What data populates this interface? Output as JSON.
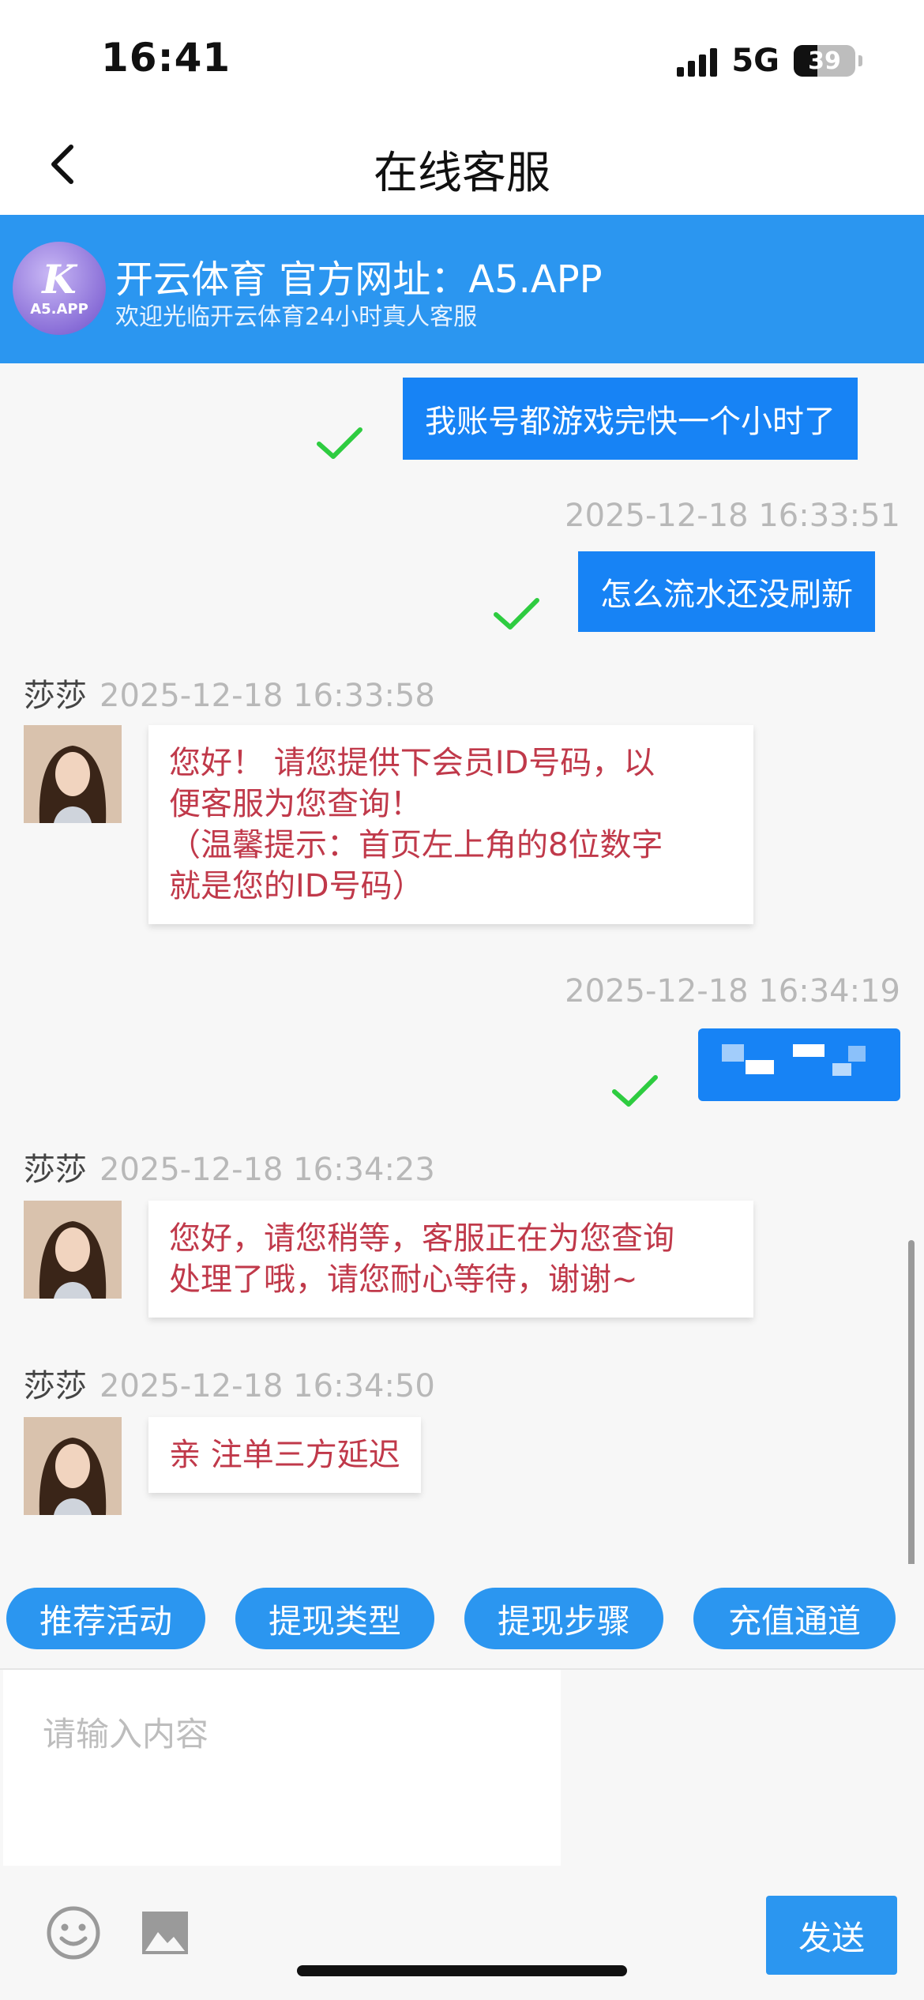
{
  "status": {
    "time": "16:41",
    "network": "5G",
    "battery": "39",
    "battery_level": 0.39
  },
  "nav": {
    "title": "在线客服"
  },
  "brand": {
    "logo_mark": "K",
    "logo_text": "A5.APP",
    "title": "开云体育 官方网址：A5.APP",
    "subtitle": "欢迎光临开云体育24小时真人客服"
  },
  "messages": {
    "me1": {
      "text": "我账号都游戏完快一个小时了"
    },
    "me2": {
      "time": "2025-12-18 16:33:51",
      "text": "怎么流水还没刷新"
    },
    "agent1": {
      "name": "莎莎",
      "time": "2025-12-18 16:33:58",
      "lines": [
        "您好！ 请您提供下会员ID号码，以",
        "便客服为您查询！",
        "（温馨提示：首页左上角的8位数字",
        "就是您的ID号码）"
      ]
    },
    "me3": {
      "time": "2025-12-18 16:34:19"
    },
    "agent2": {
      "name": "莎莎",
      "time": "2025-12-18 16:34:23",
      "lines": [
        "您好，请您稍等，客服正在为您查询",
        "处理了哦，请您耐心等待，谢谢~"
      ]
    },
    "agent3": {
      "name": "莎莎",
      "time": "2025-12-18 16:34:50",
      "text": "亲 注单三方延迟"
    }
  },
  "quick_replies": [
    "推荐活动",
    "提现类型",
    "提现步骤",
    "充值通道"
  ],
  "input": {
    "placeholder": "请输入内容",
    "send_label": "发送"
  },
  "colors": {
    "brand_blue": "#2b96f0",
    "bubble_blue": "#1783f5",
    "agent_text": "#c0394a",
    "check_green": "#2ecc40"
  }
}
